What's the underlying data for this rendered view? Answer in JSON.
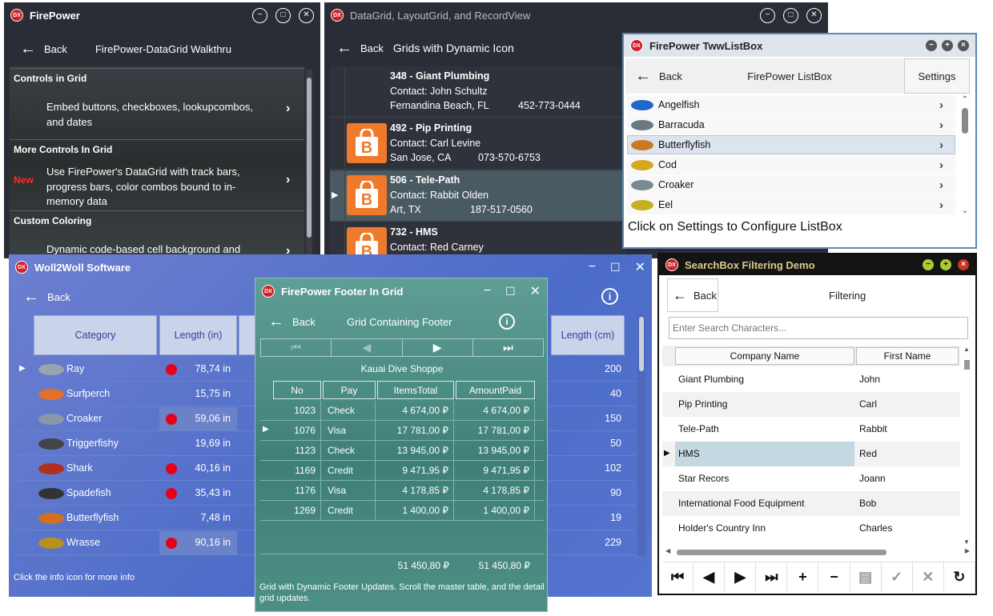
{
  "fp": {
    "title": "FirePower",
    "back": "Back",
    "header": "FirePower-DataGrid Walkthru",
    "groups": [
      {
        "title": "Controls in Grid",
        "desc": "Embed buttons, checkboxes, lookupcombos, and dates",
        "badge": ""
      },
      {
        "title": "More Controls In Grid",
        "desc": "Use FirePower's DataGrid with track bars, progress bars, color combos bound to in-memory data",
        "badge": "New"
      },
      {
        "title": "Custom Coloring",
        "desc": "Dynamic code-based cell background and",
        "badge": ""
      }
    ]
  },
  "dg": {
    "title": "DataGrid, LayoutGrid, and RecordView",
    "back": "Back",
    "header": "Grids with Dynamic Icon",
    "records": [
      {
        "head": "348 - Giant Plumbing",
        "contact": "Contact: John Schultz",
        "city": "Fernandina Beach, FL",
        "phone": "452-773-0444",
        "icon": false,
        "selected": false
      },
      {
        "head": "492 - Pip Printing",
        "contact": "Contact: Carl Levine",
        "city": "San Jose, CA",
        "phone": "073-570-6753",
        "icon": true,
        "selected": false
      },
      {
        "head": "506 - Tele-Path",
        "contact": "Contact: Rabbit Olden",
        "city": "Art, TX",
        "phone": "187-517-0560",
        "icon": true,
        "selected": true
      },
      {
        "head": "732 - HMS",
        "contact": "Contact: Red Carney",
        "city": "",
        "phone": "",
        "icon": true,
        "selected": false
      }
    ]
  },
  "lb": {
    "title": "FirePower TwwListBox",
    "back": "Back",
    "header": "FirePower ListBox",
    "settings": "Settings",
    "items": [
      "Angelfish",
      "Barracuda",
      "Butterflyfish",
      "Cod",
      "Croaker",
      "Eel"
    ],
    "selected_index": 2,
    "footer": "Click on Settings to Configure ListBox"
  },
  "ww": {
    "title": "Woll2Woll Software",
    "back": "Back",
    "headers": [
      "Category",
      "Length (in)",
      "Length (cm)"
    ],
    "rows": [
      {
        "name": "Ray",
        "inches": "78,74 in",
        "cm": "200",
        "dot": true
      },
      {
        "name": "Surfperch",
        "inches": "15,75 in",
        "cm": "40",
        "dot": false
      },
      {
        "name": "Croaker",
        "inches": "59,06 in",
        "cm": "150",
        "dot": true
      },
      {
        "name": "Triggerfishy",
        "inches": "19,69 in",
        "cm": "50",
        "dot": false
      },
      {
        "name": "Shark",
        "inches": "40,16 in",
        "cm": "102",
        "dot": true
      },
      {
        "name": "Spadefish",
        "inches": "35,43 in",
        "cm": "90",
        "dot": true
      },
      {
        "name": "Butterflyfish",
        "inches": "7,48 in",
        "cm": "19",
        "dot": false
      },
      {
        "name": "Wrasse",
        "inches": "90,16 in",
        "cm": "229",
        "dot": true
      }
    ],
    "footer": "Click the info icon for more info"
  },
  "ft": {
    "title": "FirePower Footer In Grid",
    "back": "Back",
    "header": "Grid Containing Footer",
    "master": "Kauai Dive Shoppe",
    "headers": [
      "No",
      "Pay",
      "ItemsTotal",
      "AmountPaid"
    ],
    "rows": [
      [
        "1023",
        "Check",
        "4 674,00 ₽",
        "4 674,00 ₽"
      ],
      [
        "1076",
        "Visa",
        "17 781,00 ₽",
        "17 781,00 ₽"
      ],
      [
        "1123",
        "Check",
        "13 945,00 ₽",
        "13 945,00 ₽"
      ],
      [
        "1169",
        "Credit",
        "9 471,95 ₽",
        "9 471,95 ₽"
      ],
      [
        "1176",
        "Visa",
        "4 178,85 ₽",
        "4 178,85 ₽"
      ],
      [
        "1269",
        "Credit",
        "1 400,00 ₽",
        "1 400,00 ₽"
      ]
    ],
    "current_row": 1,
    "totals": [
      "51 450,80 ₽",
      "51 450,80 ₽"
    ],
    "caption": "Grid with Dynamic Footer Updates. Scroll the master table, and the detail grid updates."
  },
  "sb": {
    "title": "SearchBox Filtering Demo",
    "back": "Back",
    "header": "Filtering",
    "search_placeholder": "Enter Search Characters...",
    "headers": [
      "Company Name",
      "First Name"
    ],
    "rows": [
      [
        "Giant Plumbing",
        "John"
      ],
      [
        "Pip Printing",
        "Carl"
      ],
      [
        "Tele-Path",
        "Rabbit"
      ],
      [
        "HMS",
        "Red"
      ],
      [
        "Star Recors",
        "Joann"
      ],
      [
        "International Food Equipment",
        "Bob"
      ],
      [
        "Holder's Country Inn",
        "Charles"
      ]
    ],
    "selected_index": 3
  }
}
